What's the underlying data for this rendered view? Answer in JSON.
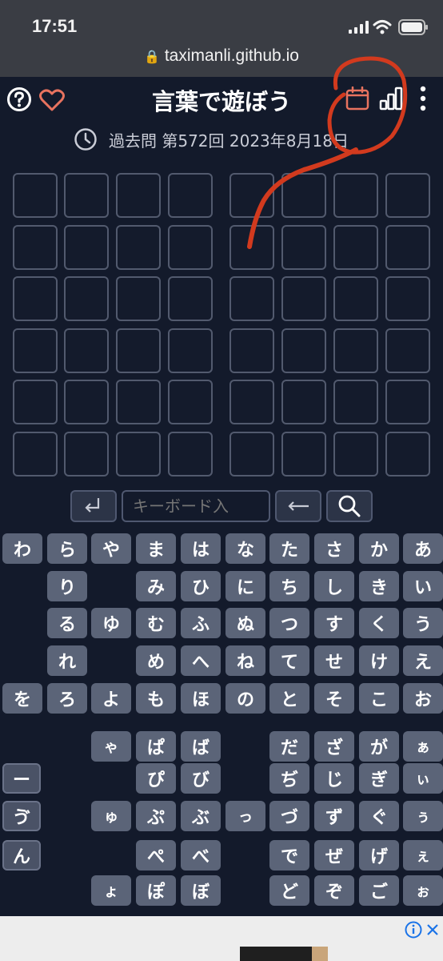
{
  "status": {
    "time": "17:51"
  },
  "browser": {
    "url": "taximanli.github.io"
  },
  "header": {
    "title": "言葉で遊ぼう",
    "subtitle": "過去問 第572回 2023年8月18日"
  },
  "icons": {
    "help": "help-circle-icon",
    "favorite": "heart-icon",
    "calendar": "calendar-icon",
    "stats": "bar-chart-icon",
    "menu": "more-vertical-icon",
    "clock": "clock-icon"
  },
  "colors": {
    "accent": "#e8735f",
    "background": "#131a2b",
    "key": "#5b6478",
    "annotation": "#d23a1e"
  },
  "grid": {
    "rows": 6,
    "cols": 8
  },
  "input": {
    "placeholder": "キーボード入"
  },
  "keyboard": {
    "main_rows": [
      [
        "わ",
        "ら",
        "や",
        "ま",
        "は",
        "な",
        "た",
        "さ",
        "か",
        "あ"
      ],
      [
        "",
        "り",
        "",
        "み",
        "ひ",
        "に",
        "ち",
        "し",
        "き",
        "い"
      ],
      [
        "",
        "る",
        "ゆ",
        "む",
        "ふ",
        "ぬ",
        "つ",
        "す",
        "く",
        "う"
      ],
      [
        "",
        "れ",
        "",
        "め",
        "へ",
        "ね",
        "て",
        "せ",
        "け",
        "え"
      ],
      [
        "を",
        "ろ",
        "よ",
        "も",
        "ほ",
        "の",
        "と",
        "そ",
        "こ",
        "お"
      ],
      [
        "",
        "",
        "ゃ",
        "ぱ",
        "ば",
        "",
        "だ",
        "ざ",
        "が",
        "ぁ"
      ],
      [
        "ー",
        "",
        "",
        "ぴ",
        "び",
        "",
        "ぢ",
        "じ",
        "ぎ",
        "ぃ"
      ],
      [
        "ゔ",
        "",
        "ゅ",
        "ぷ",
        "ぶ",
        "っ",
        "づ",
        "ず",
        "ぐ",
        "ぅ"
      ],
      [
        "ん",
        "",
        "",
        "ぺ",
        "べ",
        "",
        "で",
        "ぜ",
        "げ",
        "ぇ"
      ],
      [
        "",
        "",
        "ょ",
        "ぽ",
        "ぼ",
        "",
        "ど",
        "ぞ",
        "ご",
        "ぉ"
      ]
    ]
  }
}
